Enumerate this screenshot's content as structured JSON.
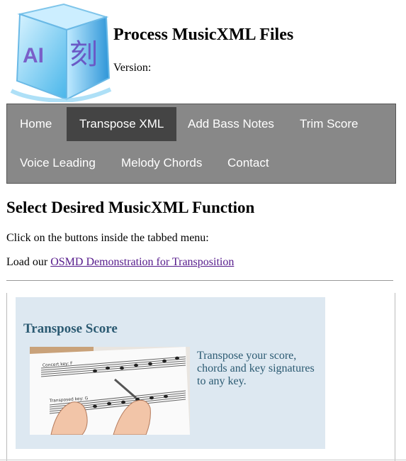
{
  "header": {
    "logo_text_left": "AI",
    "logo_text_right": "刻",
    "title": "Process MusicXML Files",
    "version_label": "Version:",
    "version_value": ""
  },
  "nav": {
    "items": [
      {
        "label": "Home",
        "active": false
      },
      {
        "label": "Transpose XML",
        "active": true
      },
      {
        "label": "Add Bass Notes",
        "active": false
      },
      {
        "label": "Trim Score",
        "active": false
      },
      {
        "label": "Voice Leading",
        "active": false
      },
      {
        "label": "Melody Chords",
        "active": false
      },
      {
        "label": "Contact",
        "active": false
      }
    ]
  },
  "main": {
    "heading": "Select Desired MusicXML Function",
    "instruction": "Click on the buttons inside the tabbed menu:",
    "load_prefix": "Load our",
    "demo_link": "OSMD Demonstration for Transposition"
  },
  "card": {
    "title": "Transpose Score",
    "image_caption_top": "Concert key: F",
    "image_caption_bottom": "Transposed key: G",
    "description": "Transpose your score, chords and key signatures to any key."
  },
  "colors": {
    "nav_bg": "#888888",
    "nav_active": "#444444",
    "card_bg": "#dde8f1",
    "card_text": "#2b5a72",
    "link": "#551a8b"
  }
}
